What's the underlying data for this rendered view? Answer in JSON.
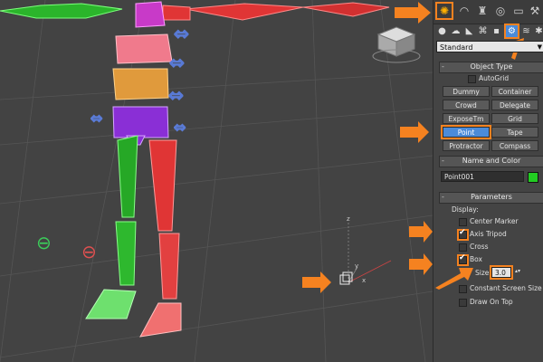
{
  "command_panel": {
    "tabs": [
      "create-tab",
      "modify-tab",
      "hierarchy-tab",
      "motion-tab",
      "display-tab",
      "utilities-tab"
    ],
    "active_tab": "create-tab",
    "subcategories": [
      "geometry",
      "shapes",
      "lights",
      "cameras",
      "helpers",
      "space-warps",
      "systems"
    ],
    "active_subcategory": "helpers",
    "dropdown_value": "Standard",
    "object_type": {
      "title": "Object Type",
      "autogrid_label": "AutoGrid",
      "buttons": [
        "Dummy",
        "Container",
        "Crowd",
        "Delegate",
        "ExposeTm",
        "Grid",
        "Point",
        "Tape",
        "Protractor",
        "Compass"
      ],
      "active_button": "Point"
    },
    "name_and_color": {
      "title": "Name and Color",
      "name_value": "Point001",
      "color": "#22cc22"
    },
    "parameters": {
      "title": "Parameters",
      "display_label": "Display:",
      "center_marker_label": "Center Marker",
      "axis_tripod_label": "Axis Tripod",
      "cross_label": "Cross",
      "box_label": "Box",
      "size_label": "Size:",
      "size_value": "3.0",
      "constant_screen_size_label": "Constant Screen Size",
      "draw_on_top_label": "Draw On Top"
    }
  },
  "viewport": {
    "point_axis_x": "x",
    "point_axis_y": "y",
    "point_axis_z": "z"
  },
  "colors": {
    "accent": "#f58220",
    "active_blue": "#4b8bd9"
  }
}
